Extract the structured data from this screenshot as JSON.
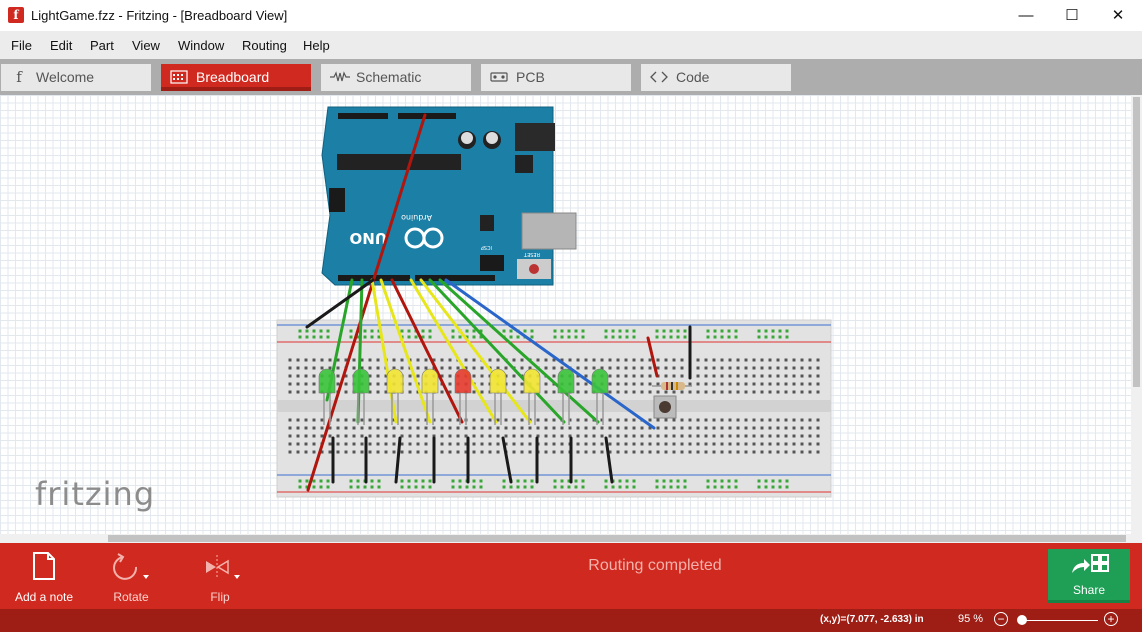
{
  "window": {
    "title": "LightGame.fzz - Fritzing - [Breadboard View]",
    "icon_glyph": "f",
    "minimize": "—",
    "maximize": "☐",
    "close": "✕"
  },
  "menu": [
    "File",
    "Edit",
    "Part",
    "View",
    "Window",
    "Routing",
    "Help"
  ],
  "tabs": [
    {
      "label": "Welcome",
      "icon": "fritzing-f-icon",
      "glyph": "f",
      "active": false
    },
    {
      "label": "Breadboard",
      "icon": "breadboard-icon",
      "glyph": "▦",
      "active": true
    },
    {
      "label": "Schematic",
      "icon": "resistor-zigzag-icon",
      "glyph": "⏦",
      "active": false
    },
    {
      "label": "PCB",
      "icon": "pcb-icon",
      "glyph": "⊟",
      "active": false
    },
    {
      "label": "Code",
      "icon": "code-brackets-icon",
      "glyph": "‹ ›",
      "active": false
    }
  ],
  "canvas": {
    "watermark": "fritzing",
    "arduino_brand": "Arduino",
    "arduino_model": "UNO",
    "reset_label": "RESET",
    "icsp_label": "ICSP",
    "leds": [
      "green",
      "green",
      "yellow",
      "yellow",
      "red",
      "yellow",
      "yellow",
      "green",
      "green"
    ]
  },
  "toolbar": {
    "add_note": "Add a note",
    "rotate": "Rotate",
    "flip": "Flip",
    "status": "Routing completed",
    "share": "Share"
  },
  "statusbar": {
    "coordinates": "(x,y)=(7.077, -2.633) in",
    "zoom": "95 %",
    "zoom_out": "−",
    "zoom_in": "+"
  },
  "colors": {
    "accent": "#d0291f",
    "accent_dark": "#9e1d15",
    "share_green": "#1f9e55",
    "arduino_teal": "#1b7fa6"
  }
}
